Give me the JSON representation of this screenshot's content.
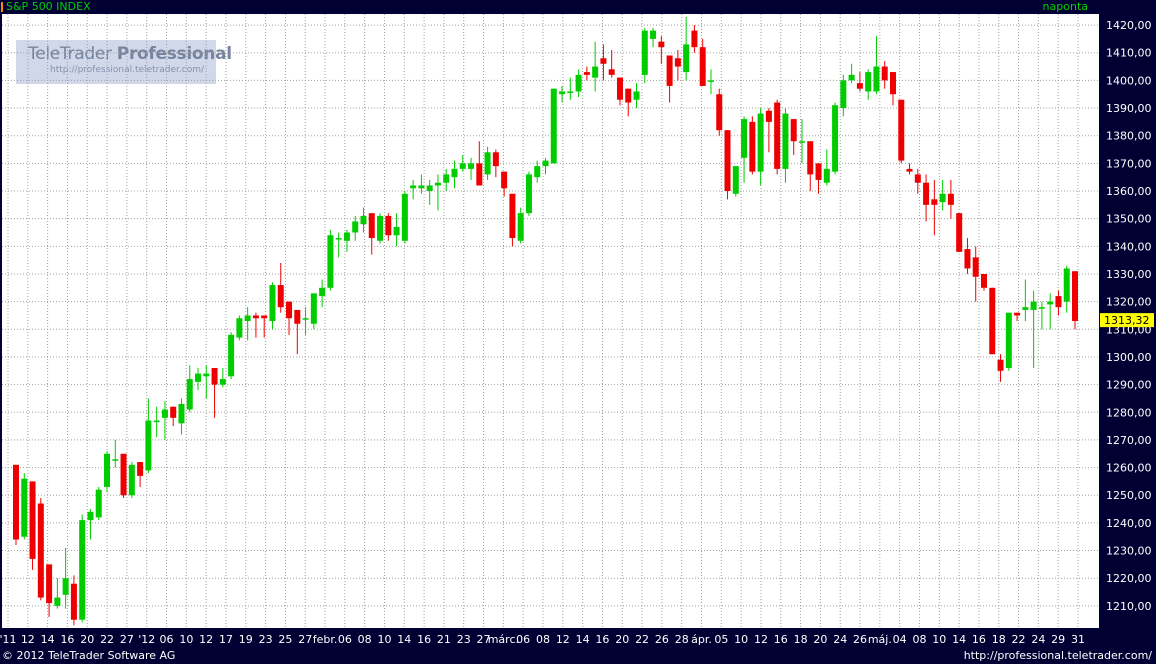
{
  "header": {
    "title": "S&P 500 INDEX",
    "period": "naponta"
  },
  "logo": {
    "name_regular": "TeleTrader",
    "name_bold": "Professional",
    "url": "http://professional.teletrader.com/"
  },
  "footer": {
    "copyright": "© 2012 TeleTrader Software AG",
    "url": "http://professional.teletrader.com/"
  },
  "colors": {
    "up": "#00cc00",
    "down": "#ee0000",
    "grid": "#a0a0a0",
    "frame": "#000033",
    "axis_text": "#ffffff",
    "last_price_bg": "#ffff00"
  },
  "chart_data": {
    "type": "candlestick",
    "title": "S&P 500 INDEX",
    "ylim": [
      1202,
      1424
    ],
    "y_ticks": [
      "1210,00",
      "1220,00",
      "1230,00",
      "1240,00",
      "1250,00",
      "1260,00",
      "1270,00",
      "1280,00",
      "1290,00",
      "1300,00",
      "1310,00",
      "1320,00",
      "1330,00",
      "1340,00",
      "1350,00",
      "1360,00",
      "1370,00",
      "1380,00",
      "1390,00",
      "1400,00",
      "1410,00",
      "1420,00"
    ],
    "last_price": "1313,32",
    "grid": true,
    "x_labels": [
      "'11",
      "12",
      "14",
      "16",
      "20",
      "22",
      "27",
      "'12",
      "06",
      "10",
      "12",
      "17",
      "19",
      "23",
      "25",
      "27",
      "febr.",
      "06",
      "08",
      "10",
      "14",
      "16",
      "21",
      "23",
      "27",
      "márc.",
      "06",
      "08",
      "12",
      "14",
      "16",
      "20",
      "22",
      "26",
      "28",
      "ápr.",
      "05",
      "10",
      "12",
      "16",
      "18",
      "20",
      "24",
      "26",
      "máj.",
      "04",
      "08",
      "10",
      "14",
      "16",
      "18",
      "22",
      "24",
      "29",
      "31"
    ],
    "series": [
      {
        "o": 1261,
        "h": 1261,
        "l": 1232,
        "c": 1234
      },
      {
        "o": 1235,
        "h": 1258,
        "l": 1234,
        "c": 1256
      },
      {
        "o": 1255,
        "h": 1255,
        "l": 1223,
        "c": 1227
      },
      {
        "o": 1247,
        "h": 1249,
        "l": 1212,
        "c": 1213
      },
      {
        "o": 1225,
        "h": 1225,
        "l": 1206,
        "c": 1211
      },
      {
        "o": 1210,
        "h": 1220,
        "l": 1209,
        "c": 1213
      },
      {
        "o": 1214,
        "h": 1231,
        "l": 1209,
        "c": 1220
      },
      {
        "o": 1218,
        "h": 1221,
        "l": 1203,
        "c": 1205
      },
      {
        "o": 1205,
        "h": 1243,
        "l": 1204,
        "c": 1241
      },
      {
        "o": 1241,
        "h": 1245,
        "l": 1234,
        "c": 1244
      },
      {
        "o": 1242,
        "h": 1253,
        "l": 1241,
        "c": 1252
      },
      {
        "o": 1253,
        "h": 1266,
        "l": 1251,
        "c": 1265
      },
      {
        "o": 1263,
        "h": 1270,
        "l": 1260,
        "c": 1263
      },
      {
        "o": 1265,
        "h": 1265,
        "l": 1249,
        "c": 1250
      },
      {
        "o": 1250,
        "h": 1262,
        "l": 1249,
        "c": 1261
      },
      {
        "o": 1262,
        "h": 1262,
        "l": 1253,
        "c": 1257
      },
      {
        "o": 1259,
        "h": 1285,
        "l": 1258,
        "c": 1277
      },
      {
        "o": 1277,
        "h": 1282,
        "l": 1271,
        "c": 1277
      },
      {
        "o": 1278,
        "h": 1284,
        "l": 1270,
        "c": 1281
      },
      {
        "o": 1282,
        "h": 1282,
        "l": 1275,
        "c": 1278
      },
      {
        "o": 1276,
        "h": 1285,
        "l": 1272,
        "c": 1283
      },
      {
        "o": 1281,
        "h": 1297,
        "l": 1280,
        "c": 1292
      },
      {
        "o": 1291,
        "h": 1296,
        "l": 1288,
        "c": 1294
      },
      {
        "o": 1293,
        "h": 1297,
        "l": 1285,
        "c": 1294
      },
      {
        "o": 1296,
        "h": 1296,
        "l": 1278,
        "c": 1290
      },
      {
        "o": 1290,
        "h": 1296,
        "l": 1289,
        "c": 1292
      },
      {
        "o": 1293,
        "h": 1309,
        "l": 1292,
        "c": 1308
      },
      {
        "o": 1307,
        "h": 1315,
        "l": 1306,
        "c": 1314
      },
      {
        "o": 1313,
        "h": 1318,
        "l": 1306,
        "c": 1315
      },
      {
        "o": 1315,
        "h": 1316,
        "l": 1307,
        "c": 1314
      },
      {
        "o": 1315,
        "h": 1315,
        "l": 1307,
        "c": 1314
      },
      {
        "o": 1313,
        "h": 1327,
        "l": 1310,
        "c": 1326
      },
      {
        "o": 1326,
        "h": 1334,
        "l": 1316,
        "c": 1318
      },
      {
        "o": 1320,
        "h": 1320,
        "l": 1308,
        "c": 1314
      },
      {
        "o": 1317,
        "h": 1317,
        "l": 1301,
        "c": 1312
      },
      {
        "o": 1314,
        "h": 1318,
        "l": 1308,
        "c": 1314
      },
      {
        "o": 1312,
        "h": 1323,
        "l": 1310,
        "c": 1323
      },
      {
        "o": 1322,
        "h": 1328,
        "l": 1318,
        "c": 1325
      },
      {
        "o": 1325,
        "h": 1346,
        "l": 1324,
        "c": 1344
      },
      {
        "o": 1343,
        "h": 1345,
        "l": 1336,
        "c": 1343
      },
      {
        "o": 1342,
        "h": 1346,
        "l": 1338,
        "c": 1345
      },
      {
        "o": 1345,
        "h": 1351,
        "l": 1342,
        "c": 1349
      },
      {
        "o": 1348,
        "h": 1354,
        "l": 1345,
        "c": 1351
      },
      {
        "o": 1352,
        "h": 1352,
        "l": 1337,
        "c": 1343
      },
      {
        "o": 1342,
        "h": 1352,
        "l": 1341,
        "c": 1351
      },
      {
        "o": 1351,
        "h": 1352,
        "l": 1342,
        "c": 1344
      },
      {
        "o": 1344,
        "h": 1352,
        "l": 1340,
        "c": 1347
      },
      {
        "o": 1342,
        "h": 1360,
        "l": 1341,
        "c": 1359
      },
      {
        "o": 1361,
        "h": 1364,
        "l": 1357,
        "c": 1362
      },
      {
        "o": 1361,
        "h": 1366,
        "l": 1359,
        "c": 1362
      },
      {
        "o": 1360,
        "h": 1364,
        "l": 1355,
        "c": 1362
      },
      {
        "o": 1362,
        "h": 1366,
        "l": 1353,
        "c": 1363
      },
      {
        "o": 1363,
        "h": 1368,
        "l": 1360,
        "c": 1366
      },
      {
        "o": 1365,
        "h": 1371,
        "l": 1361,
        "c": 1368
      },
      {
        "o": 1368,
        "h": 1373,
        "l": 1367,
        "c": 1370
      },
      {
        "o": 1368,
        "h": 1372,
        "l": 1364,
        "c": 1370
      },
      {
        "o": 1370,
        "h": 1378,
        "l": 1364,
        "c": 1362
      },
      {
        "o": 1366,
        "h": 1376,
        "l": 1364,
        "c": 1374
      },
      {
        "o": 1374,
        "h": 1375,
        "l": 1365,
        "c": 1369
      },
      {
        "o": 1367,
        "h": 1367,
        "l": 1358,
        "c": 1361
      },
      {
        "o": 1359,
        "h": 1359,
        "l": 1340,
        "c": 1343
      },
      {
        "o": 1342,
        "h": 1354,
        "l": 1341,
        "c": 1352
      },
      {
        "o": 1352,
        "h": 1367,
        "l": 1351,
        "c": 1366
      },
      {
        "o": 1365,
        "h": 1371,
        "l": 1363,
        "c": 1369
      },
      {
        "o": 1369,
        "h": 1372,
        "l": 1366,
        "c": 1371
      },
      {
        "o": 1370,
        "h": 1397,
        "l": 1370,
        "c": 1397
      },
      {
        "o": 1395,
        "h": 1398,
        "l": 1392,
        "c": 1396
      },
      {
        "o": 1396,
        "h": 1401,
        "l": 1393,
        "c": 1396
      },
      {
        "o": 1396,
        "h": 1404,
        "l": 1394,
        "c": 1402
      },
      {
        "o": 1403,
        "h": 1405,
        "l": 1400,
        "c": 1402
      },
      {
        "o": 1401,
        "h": 1414,
        "l": 1396,
        "c": 1405
      },
      {
        "o": 1408,
        "h": 1413,
        "l": 1400,
        "c": 1406
      },
      {
        "o": 1404,
        "h": 1411,
        "l": 1401,
        "c": 1402
      },
      {
        "o": 1401,
        "h": 1401,
        "l": 1391,
        "c": 1393
      },
      {
        "o": 1397,
        "h": 1397,
        "l": 1387,
        "c": 1392
      },
      {
        "o": 1393,
        "h": 1399,
        "l": 1390,
        "c": 1396
      },
      {
        "o": 1402,
        "h": 1419,
        "l": 1399,
        "c": 1418
      },
      {
        "o": 1415,
        "h": 1419,
        "l": 1412,
        "c": 1418
      },
      {
        "o": 1414,
        "h": 1416,
        "l": 1406,
        "c": 1412
      },
      {
        "o": 1409,
        "h": 1409,
        "l": 1392,
        "c": 1398
      },
      {
        "o": 1408,
        "h": 1411,
        "l": 1400,
        "c": 1405
      },
      {
        "o": 1403,
        "h": 1423,
        "l": 1400,
        "c": 1413
      },
      {
        "o": 1418,
        "h": 1420,
        "l": 1410,
        "c": 1412
      },
      {
        "o": 1412,
        "h": 1415,
        "l": 1398,
        "c": 1398
      },
      {
        "o": 1400,
        "h": 1404,
        "l": 1395,
        "c": 1400
      },
      {
        "o": 1395,
        "h": 1397,
        "l": 1380,
        "c": 1382
      },
      {
        "o": 1382,
        "h": 1382,
        "l": 1357,
        "c": 1360
      },
      {
        "o": 1359,
        "h": 1368,
        "l": 1358,
        "c": 1369
      },
      {
        "o": 1372,
        "h": 1387,
        "l": 1363,
        "c": 1386
      },
      {
        "o": 1385,
        "h": 1387,
        "l": 1366,
        "c": 1367
      },
      {
        "o": 1367,
        "h": 1390,
        "l": 1362,
        "c": 1388
      },
      {
        "o": 1389,
        "h": 1390,
        "l": 1374,
        "c": 1385
      },
      {
        "o": 1392,
        "h": 1393,
        "l": 1366,
        "c": 1368
      },
      {
        "o": 1368,
        "h": 1390,
        "l": 1363,
        "c": 1388
      },
      {
        "o": 1386,
        "h": 1386,
        "l": 1373,
        "c": 1378
      },
      {
        "o": 1378,
        "h": 1386,
        "l": 1370,
        "c": 1378
      },
      {
        "o": 1378,
        "h": 1378,
        "l": 1360,
        "c": 1366
      },
      {
        "o": 1370,
        "h": 1370,
        "l": 1359,
        "c": 1364
      },
      {
        "o": 1363,
        "h": 1375,
        "l": 1362,
        "c": 1368
      },
      {
        "o": 1367,
        "h": 1392,
        "l": 1366,
        "c": 1391
      },
      {
        "o": 1390,
        "h": 1402,
        "l": 1387,
        "c": 1400
      },
      {
        "o": 1400,
        "h": 1406,
        "l": 1399,
        "c": 1402
      },
      {
        "o": 1399,
        "h": 1403,
        "l": 1396,
        "c": 1397
      },
      {
        "o": 1396,
        "h": 1404,
        "l": 1393,
        "c": 1403
      },
      {
        "o": 1396,
        "h": 1416,
        "l": 1395,
        "c": 1405
      },
      {
        "o": 1405,
        "h": 1407,
        "l": 1397,
        "c": 1400
      },
      {
        "o": 1403,
        "h": 1403,
        "l": 1391,
        "c": 1395
      },
      {
        "o": 1393,
        "h": 1393,
        "l": 1370,
        "c": 1371
      },
      {
        "o": 1368,
        "h": 1370,
        "l": 1366,
        "c": 1367
      },
      {
        "o": 1366,
        "h": 1368,
        "l": 1359,
        "c": 1363
      },
      {
        "o": 1363,
        "h": 1366,
        "l": 1349,
        "c": 1355
      },
      {
        "o": 1357,
        "h": 1364,
        "l": 1344,
        "c": 1355
      },
      {
        "o": 1356,
        "h": 1364,
        "l": 1353,
        "c": 1359
      },
      {
        "o": 1359,
        "h": 1364,
        "l": 1350,
        "c": 1355
      },
      {
        "o": 1352,
        "h": 1352,
        "l": 1338,
        "c": 1338
      },
      {
        "o": 1339,
        "h": 1343,
        "l": 1330,
        "c": 1332
      },
      {
        "o": 1336,
        "h": 1340,
        "l": 1320,
        "c": 1329
      },
      {
        "o": 1330,
        "h": 1330,
        "l": 1324,
        "c": 1325
      },
      {
        "o": 1325,
        "h": 1325,
        "l": 1301,
        "c": 1301
      },
      {
        "o": 1299,
        "h": 1301,
        "l": 1291,
        "c": 1295
      },
      {
        "o": 1296,
        "h": 1316,
        "l": 1295,
        "c": 1316
      },
      {
        "o": 1316,
        "h": 1316,
        "l": 1313,
        "c": 1315
      },
      {
        "o": 1317,
        "h": 1328,
        "l": 1313,
        "c": 1318
      },
      {
        "o": 1317,
        "h": 1324,
        "l": 1296,
        "c": 1320
      },
      {
        "o": 1318,
        "h": 1320,
        "l": 1310,
        "c": 1318
      },
      {
        "o": 1319,
        "h": 1323,
        "l": 1310,
        "c": 1320
      },
      {
        "o": 1322,
        "h": 1324,
        "l": 1315,
        "c": 1318
      },
      {
        "o": 1320,
        "h": 1333,
        "l": 1316,
        "c": 1332
      },
      {
        "o": 1331,
        "h": 1331,
        "l": 1310,
        "c": 1313
      }
    ]
  }
}
